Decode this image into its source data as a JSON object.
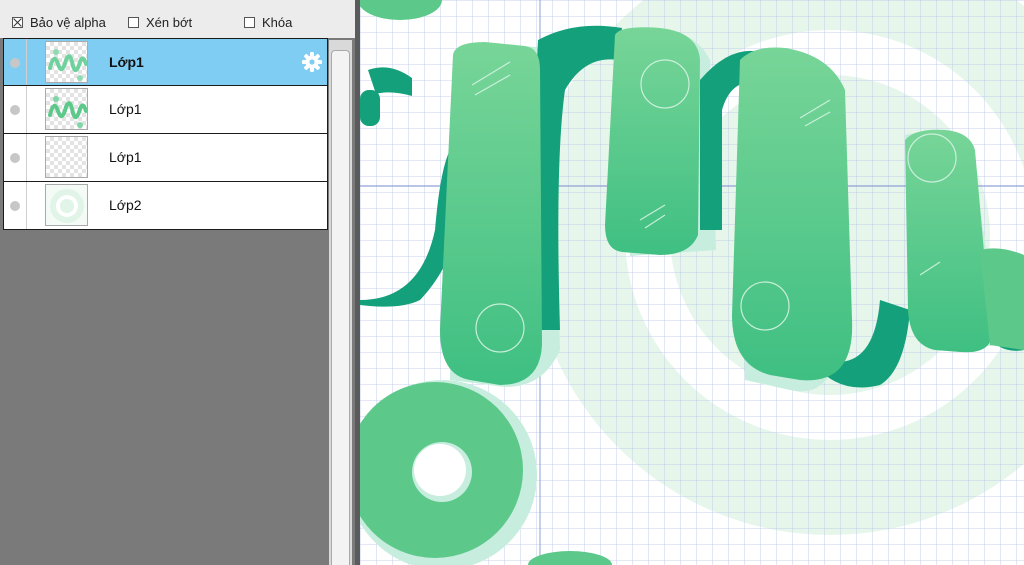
{
  "options": {
    "alpha_protect": {
      "label": "Bảo vệ alpha",
      "checked": true
    },
    "clip": {
      "label": "Xén bớt",
      "checked": false
    },
    "lock": {
      "label": "Khóa",
      "checked": false
    }
  },
  "layers": [
    {
      "name": "Lớp1",
      "selected": true,
      "thumbnail": "lettering"
    },
    {
      "name": "Lớp1",
      "selected": false,
      "thumbnail": "lettering"
    },
    {
      "name": "Lớp1",
      "selected": false,
      "thumbnail": "empty"
    },
    {
      "name": "Lớp2",
      "selected": false,
      "thumbnail": "circle"
    }
  ],
  "colors": {
    "selection": "#7fcdf2",
    "ribbon_light": "#5cc98a",
    "ribbon_dark": "#15a47a",
    "shadow": "#c6eddd",
    "grid": "#b8c3e6"
  }
}
